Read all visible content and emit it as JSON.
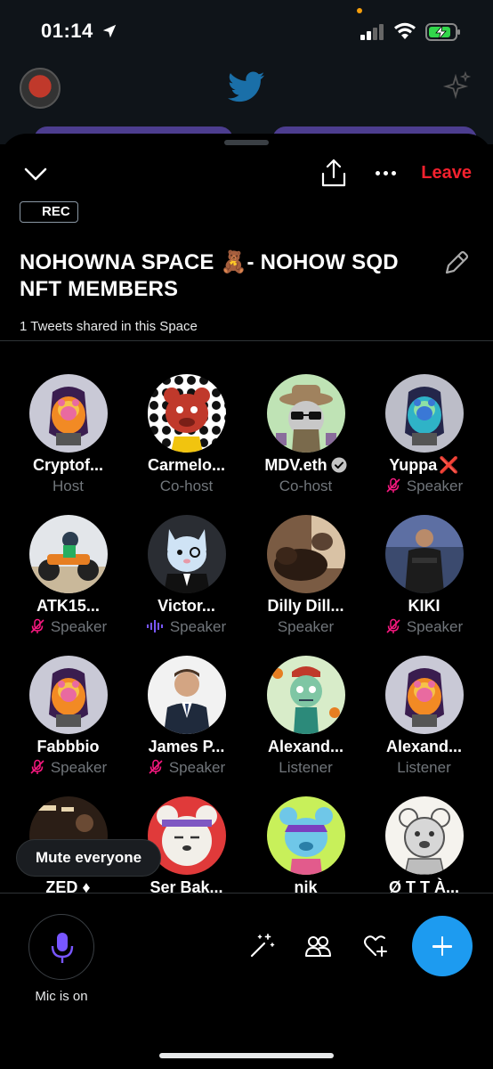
{
  "status_bar": {
    "time": "01:14"
  },
  "space": {
    "rec_label": "REC",
    "title": "NOHOWNA SPACE 🧸- NOHOW SQD NFT MEMBERS",
    "tweets_shared": "1 Tweets shared in this Space",
    "leave_label": "Leave"
  },
  "participants": [
    {
      "name": "Cryptof...",
      "role": "Host",
      "status": "none",
      "avatar": "lava-lamp-bear-icon"
    },
    {
      "name": "Carmelo...",
      "role": "Co-host",
      "status": "none",
      "avatar": "red-bear-polka-icon"
    },
    {
      "name": "MDV.eth",
      "role": "Co-host",
      "status": "none",
      "verified": true,
      "avatar": "explorer-cat-icon"
    },
    {
      "name": "Yuppa",
      "suffix": "❌",
      "role": "Speaker",
      "status": "muted",
      "avatar": "blue-lamp-bear-icon"
    },
    {
      "name": "ATK15...",
      "role": "Speaker",
      "status": "muted",
      "avatar": "atv-rider-icon"
    },
    {
      "name": "Victor...",
      "role": "Speaker",
      "status": "speaking",
      "avatar": "white-cat-suit-icon"
    },
    {
      "name": "Dilly Dill...",
      "role": "Speaker",
      "status": "none",
      "avatar": "sleeping-dog-icon"
    },
    {
      "name": "KIKI",
      "role": "Speaker",
      "status": "muted",
      "avatar": "man-photo-icon"
    },
    {
      "name": "Fabbbio",
      "role": "Speaker",
      "status": "muted",
      "avatar": "lava-lamp-bear-icon"
    },
    {
      "name": "James P...",
      "role": "Speaker",
      "status": "muted",
      "avatar": "man-suit-photo-icon"
    },
    {
      "name": "Alexand...",
      "role": "Listener",
      "status": "none",
      "avatar": "zombie-cartoon-icon"
    },
    {
      "name": "Alexand...",
      "role": "Listener",
      "status": "none",
      "avatar": "lava-lamp-bear-icon"
    },
    {
      "name": "ZED ♦",
      "role": "",
      "status": "none",
      "avatar": "dark-photo-icon"
    },
    {
      "name": "Ser Bak...",
      "role": "",
      "status": "none",
      "avatar": "white-bear-headband-icon"
    },
    {
      "name": "nik",
      "role": "",
      "status": "none",
      "avatar": "blue-bear-cap-icon"
    },
    {
      "name": "Ø T T À...",
      "role": "",
      "status": "none",
      "avatar": "sketch-bear-icon"
    }
  ],
  "mute_everyone_label": "Mute everyone",
  "mic_label": "Mic is on",
  "colors": {
    "accent": "#1d9bf0",
    "leave": "#f4212e",
    "muted": "#f91880",
    "speaking": "#7856ff",
    "mic": "#7856ff"
  }
}
